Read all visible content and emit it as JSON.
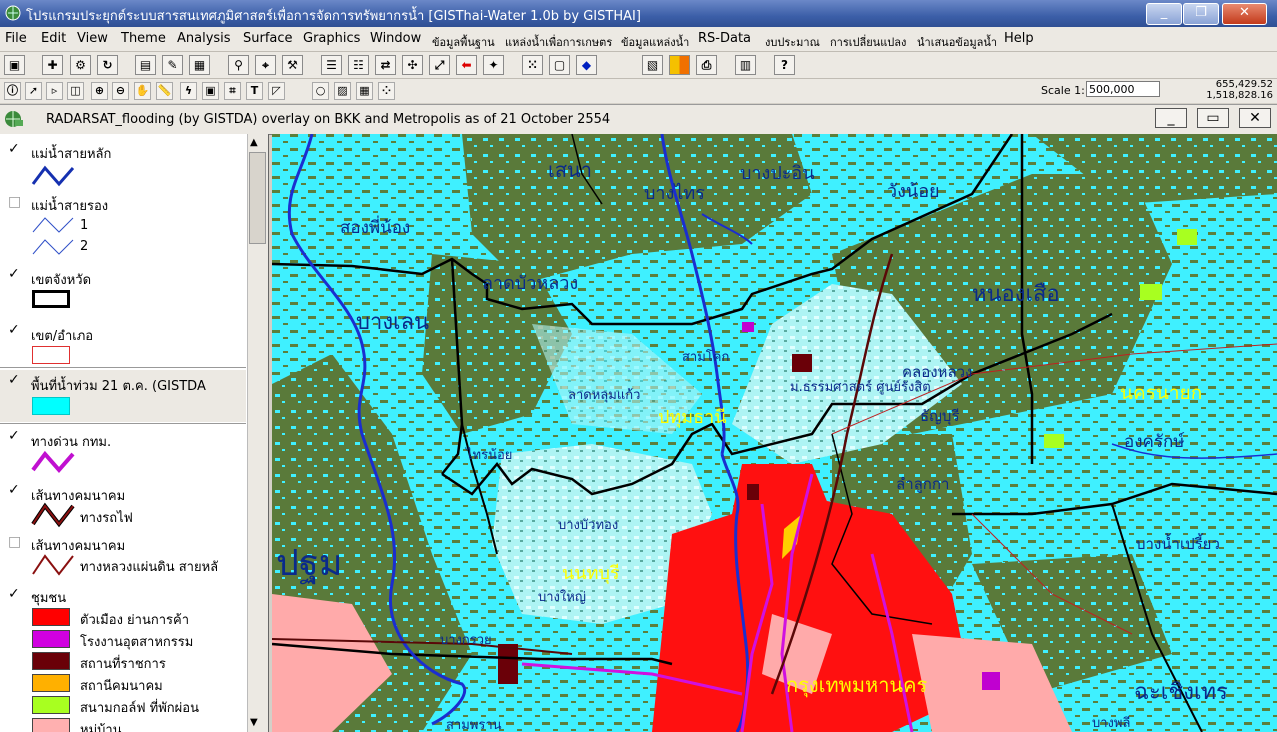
{
  "window": {
    "title": "โปรแกรมประยุกต์ระบบสารสนเทศภูมิศาสตร์เพื่อการจัดการทรัพยากรน้ำ  [GISThai-Water 1.0b   by GISTHAI]"
  },
  "menu": [
    "File",
    "Edit",
    "View",
    "Theme",
    "Analysis",
    "Surface",
    "Graphics",
    "Window",
    "ข้อมูลพื้นฐาน",
    "แหล่งน้ำเพื่อการเกษตร",
    "ข้อมูลแหล่งน้ำ",
    "RS-Data",
    "งบประมาณ",
    "การเปลี่ยนแปลง",
    "นำเสนอข้อมูลน้ำ",
    "Help"
  ],
  "toolbar2": {
    "scale_label": "Scale 1:",
    "scale_value": "500,000",
    "coord_x": "655,429.52",
    "coord_y": "1,518,828.16"
  },
  "view": {
    "title": "RADARSAT_flooding (by GISTDA) overlay on BKK and Metropolis as of 21 October 2554"
  },
  "legend": {
    "layers": [
      {
        "label": "แม่น้ำสายหลัก",
        "checked": true
      },
      {
        "label": "แม่น้ำสายรอง",
        "checked": false,
        "sub": [
          "1",
          "2"
        ]
      },
      {
        "label": "เขตจังหวัด",
        "checked": true
      },
      {
        "label": "เขต/อำเภอ",
        "checked": true
      },
      {
        "label": "พื้นที่น้ำท่วม 21 ต.ค. (GISTDA",
        "checked": true
      },
      {
        "label": "ทางด่วน กทม.",
        "checked": true
      },
      {
        "label": "เส้นทางคมนาคม",
        "checked": true,
        "sub_label": "ทางรถไฟ"
      },
      {
        "label": "เส้นทางคมนาคม",
        "checked": false,
        "sub_label": "ทางหลวงแผ่นดิน สายหลั"
      },
      {
        "label": "ชุมชน",
        "checked": true
      }
    ],
    "community_classes": [
      {
        "label": "ตัวเมือง ย่านการค้า",
        "color": "#ff0000"
      },
      {
        "label": "โรงงานอุตสาหกรรม",
        "color": "#d000e0"
      },
      {
        "label": "สถานที่ราชการ",
        "color": "#6a0008"
      },
      {
        "label": "สถานีคมนาคม",
        "color": "#ffb000"
      },
      {
        "label": "สนามกอล์ฟ ที่พักผ่อน",
        "color": "#a8ff20"
      },
      {
        "label": "หมู่บ้าน",
        "color": "#ffb0b0"
      }
    ]
  },
  "map": {
    "labels": {
      "sena": "เสนา",
      "bang_sai": "บางไทร",
      "bang_pahan": "บางปะอิน",
      "wang_noi": "วังน้อย",
      "song_phi_nong": "สองพี่น้อง",
      "lat_bua_luang": "ลาดบัวหลวง",
      "bang_len": "บางเลน",
      "nong_suea": "หนองเสือ",
      "sam_khok": "สามโคก",
      "khlong_luang": "คลองหลวง",
      "thammasat": "ม.ธรรมศาสตร์ ศูนย์รังสิต",
      "lat_lum_kaeo": "ลาดหลุมแก้ว",
      "pathum_thani": "ปทุมธานี",
      "thanyaburi": "ธัญบุรี",
      "nakhon_nayok": "นครนายก",
      "ongkharak": "องครักษ์",
      "sai_noi": "ไทรน้อย",
      "lam_luk_ka": "ลำลูกกา",
      "bang_bua_thong": "บางบัวทอง",
      "nonthaburi": "นนทบุรี",
      "bang_yai": "บางใหญ่",
      "bang_nam_priao": "บางน้ำเปรี้ยว",
      "pathom": "ปฐม",
      "bang_kruai": "บางกรวย",
      "bangkok": "กรุงเทพมหานคร",
      "chachoengsao": "ฉะเชิงเทร",
      "bang_phli": "บางพลี",
      "sam_phran": "สามพราน"
    }
  }
}
